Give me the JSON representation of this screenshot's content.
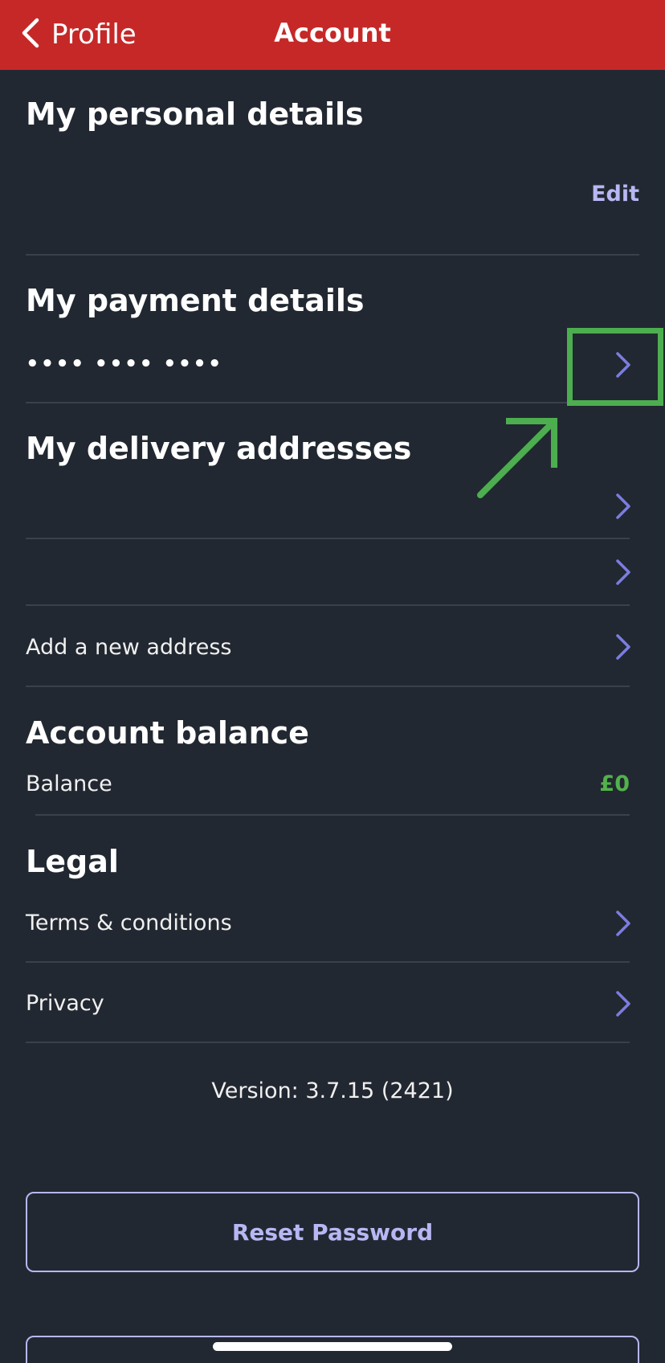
{
  "header": {
    "back_label": "Profile",
    "title": "Account"
  },
  "personal": {
    "title": "My personal details",
    "edit_label": "Edit"
  },
  "payment": {
    "title": "My payment details",
    "masked_card": "•••• •••• ••••"
  },
  "delivery": {
    "title": "My delivery addresses",
    "add_label": "Add a new address"
  },
  "balance": {
    "title": "Account balance",
    "label": "Balance",
    "value": "£0"
  },
  "legal": {
    "title": "Legal",
    "terms": "Terms & conditions",
    "privacy": "Privacy"
  },
  "version": "Version: 3.7.15 (2421)",
  "buttons": {
    "reset_password": "Reset Password"
  },
  "colors": {
    "header": "#c62828",
    "background": "#222831",
    "accent": "#b8b7f4",
    "chevron": "#7b7de0",
    "balance": "#52b24b",
    "annotation": "#4cae4f"
  }
}
